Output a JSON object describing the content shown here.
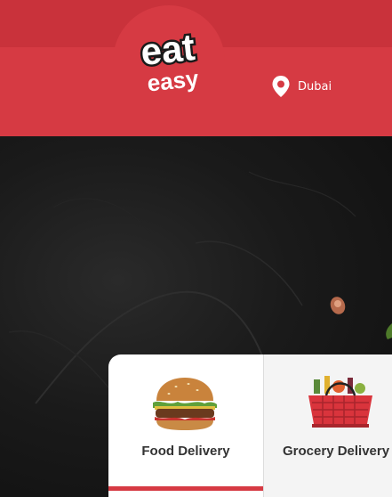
{
  "header": {
    "logo_text_top": "eat",
    "logo_text_bottom": "easy",
    "location": "Dubai",
    "location_icon": "map-pin-icon",
    "colors": {
      "brand_red": "#d63a43",
      "brand_red_dark": "#c9323b"
    }
  },
  "services": {
    "tabs": [
      {
        "label": "Food Delivery",
        "icon": "burger-icon",
        "active": true
      },
      {
        "label": "Grocery Delivery",
        "icon": "grocery-basket-icon",
        "active": false
      }
    ]
  }
}
